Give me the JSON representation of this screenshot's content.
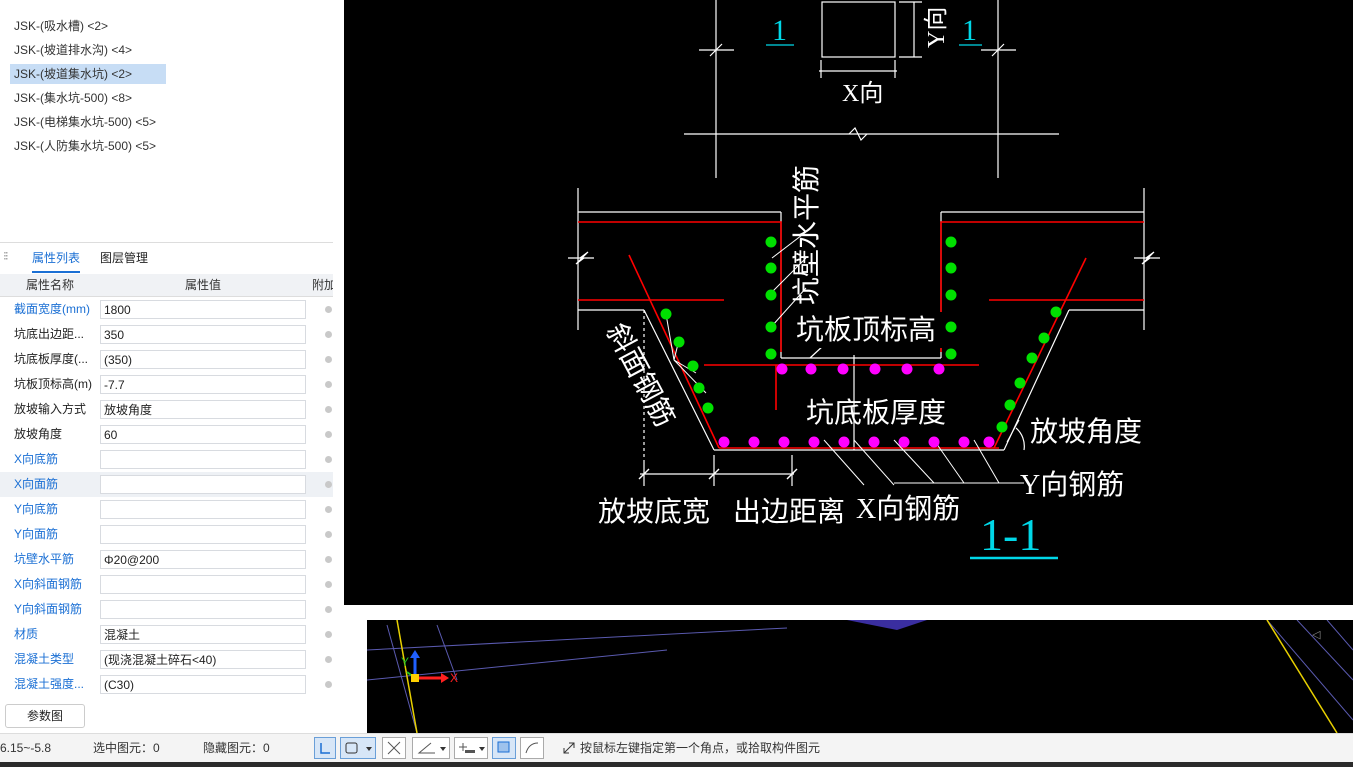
{
  "tree": {
    "items": [
      {
        "label": "JSK-(吸水槽) <2>"
      },
      {
        "label": "JSK-(坡道排水沟) <4>"
      },
      {
        "label": "JSK-(坡道集水坑) <2>"
      },
      {
        "label": "JSK-(集水坑-500) <8>"
      },
      {
        "label": "JSK-(电梯集水坑-500) <5>"
      },
      {
        "label": "JSK-(人防集水坑-500) <5>"
      }
    ]
  },
  "tabs": {
    "properties": "属性列表",
    "layers": "图层管理"
  },
  "grid": {
    "col_name": "属性名称",
    "col_value": "属性值",
    "col_extra": "附加",
    "rows": [
      {
        "name": "截面宽度(mm)",
        "value": "1800"
      },
      {
        "name": "坑底出边距...",
        "value": "350"
      },
      {
        "name": "坑底板厚度(...",
        "value": "(350)"
      },
      {
        "name": "坑板顶标高(m)",
        "value": "-7.7"
      },
      {
        "name": "放坡输入方式",
        "value": "放坡角度"
      },
      {
        "name": "放坡角度",
        "value": "60"
      },
      {
        "name": "X向底筋",
        "value": ""
      },
      {
        "name": "X向面筋",
        "value": ""
      },
      {
        "name": "Y向底筋",
        "value": ""
      },
      {
        "name": "Y向面筋",
        "value": ""
      },
      {
        "name": "坑壁水平筋",
        "value": "Φ20@200"
      },
      {
        "name": "X向斜面钢筋",
        "value": ""
      },
      {
        "name": "Y向斜面钢筋",
        "value": ""
      },
      {
        "name": "材质",
        "value": "混凝土"
      },
      {
        "name": "混凝土类型",
        "value": "(现浇混凝土碎石<40)"
      },
      {
        "name": "混凝土强度...",
        "value": "(C30)"
      }
    ]
  },
  "param_button": "参数图",
  "diagram": {
    "section_mark_left": "1",
    "section_mark_right": "1",
    "x_dir": "X向",
    "y_dir": "Y向",
    "wall_horizontal_rebar": "坑壁水平筋",
    "slab_top_elevation": "坑板顶标高",
    "slope_rebar": "斜面钢筋",
    "bottom_slab_thickness": "坑底板厚度",
    "slope_angle": "放坡角度",
    "y_rebar": "Y向钢筋",
    "x_rebar": "X向钢筋",
    "slope_bottom_width": "放坡底宽",
    "edge_distance": "出边距离",
    "section_title": "1-1"
  },
  "status": {
    "coords": "6.15~-5.8",
    "selected": "选中图元：0",
    "hidden": "隐藏图元：0",
    "hint": "按鼠标左键指定第一个角点，或拾取构件图元"
  },
  "axes": {
    "x": "X",
    "y": "Y"
  },
  "colors": {
    "accent": "#1a6fd4",
    "rebar_red": "#ff0000",
    "rebar_green": "#00e000",
    "rebar_magenta": "#ff00ff",
    "cyan": "#00d8e8"
  }
}
